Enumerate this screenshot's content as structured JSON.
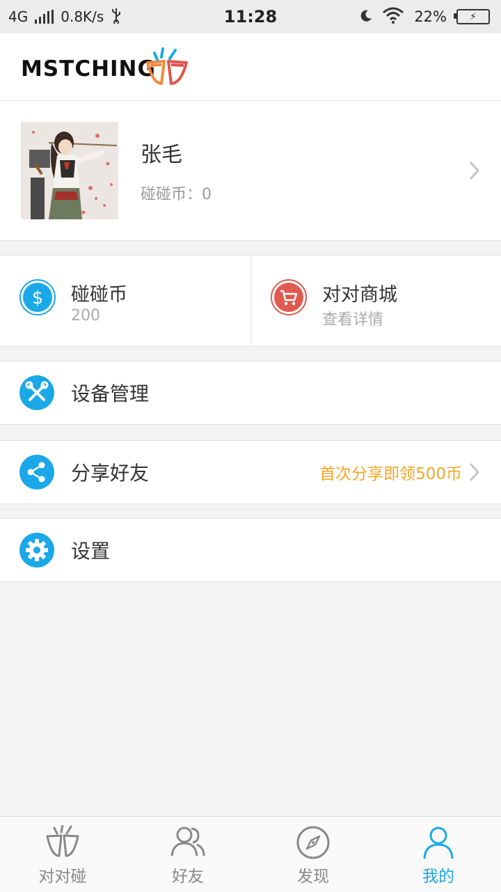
{
  "status_bar": {
    "network": "4G",
    "speed": "0.8K/s",
    "time": "11:28",
    "battery": "22%"
  },
  "header": {
    "logo_text": "MSTCHING"
  },
  "profile": {
    "name": "张毛",
    "coin_label": "碰碰币：",
    "coin_value": "0"
  },
  "cards": {
    "coins": {
      "title": "碰碰币",
      "value": "200",
      "icon": "dollar-icon"
    },
    "mall": {
      "title": "对对商城",
      "subtitle": "查看详情",
      "icon": "cart-icon"
    }
  },
  "menu": {
    "device": {
      "label": "设备管理",
      "icon": "wrench-icon"
    },
    "share": {
      "label": "分享好友",
      "extra": "首次分享即领500币",
      "icon": "share-icon"
    },
    "settings": {
      "label": "设置",
      "icon": "gear-icon"
    }
  },
  "tabs": [
    {
      "label": "对对碰",
      "icon": "match-icon"
    },
    {
      "label": "好友",
      "icon": "friends-icon"
    },
    {
      "label": "发现",
      "icon": "compass-icon"
    },
    {
      "label": "我的",
      "icon": "user-icon",
      "active": true
    }
  ],
  "colors": {
    "accent": "#1aa8e8",
    "mall_red": "#e05a4f",
    "promo_orange": "#f5a623",
    "logo_orange": "#f08a3c",
    "logo_red": "#e0524a"
  }
}
